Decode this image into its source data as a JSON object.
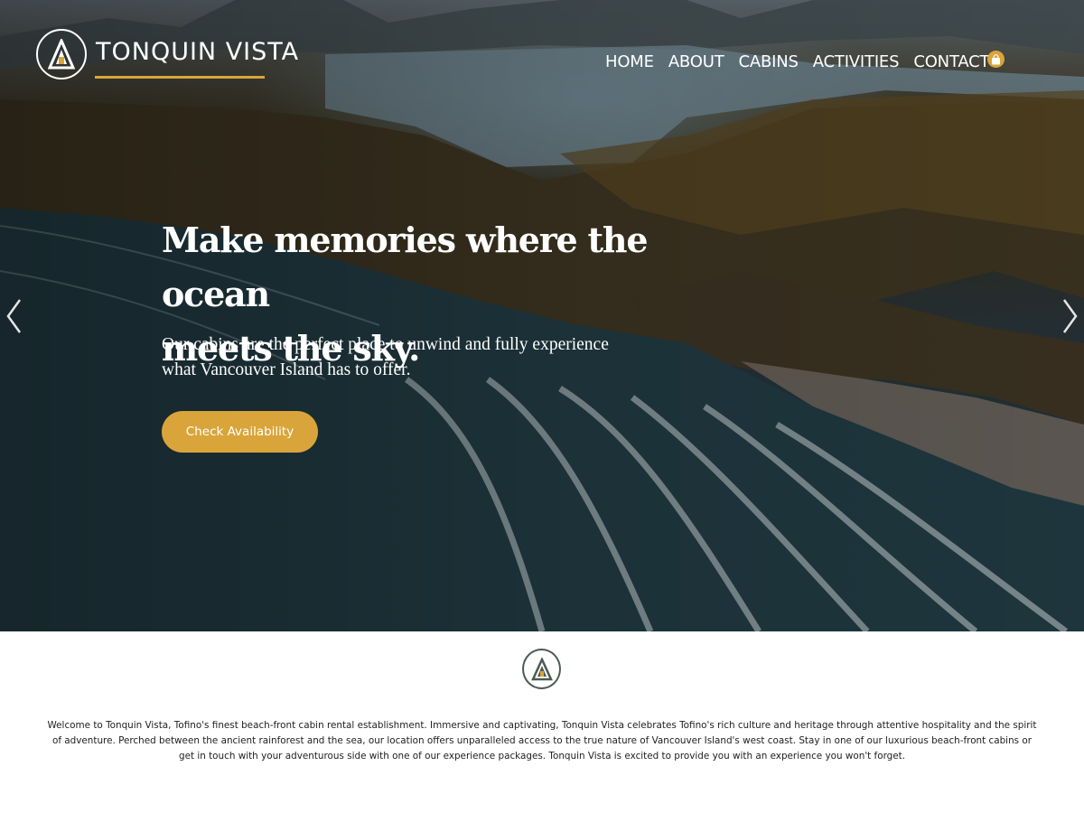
{
  "brand": {
    "name": "TONQUIN VISTA"
  },
  "nav": {
    "items": [
      {
        "label": "HOME"
      },
      {
        "label": "ABOUT"
      },
      {
        "label": "CABINS"
      },
      {
        "label": "ACTIVITIES"
      },
      {
        "label": "CONTACT"
      }
    ],
    "cart_icon": "shopping-bag-icon"
  },
  "hero": {
    "title_line1": "Make memories where the ocean",
    "title_line2": "meets the sky.",
    "subtitle_line1": "Our cabins are the perfect place to unwind and fully experience",
    "subtitle_line2": "what Vancouver Island has to offer.",
    "cta_label": "Check Availability",
    "prev_icon": "chevron-left-icon",
    "next_icon": "chevron-right-icon"
  },
  "intro": {
    "text": "Welcome to Tonquin Vista, Tofino's finest beach-front cabin rental establishment. Immersive and captivating, Tonquin Vista celebrates Tofino's rich culture and heritage through attentive hospitality and the spirit of adventure. Perched between the ancient rainforest and the sea, our location offers unparalleled access to the true nature of Vancouver Island's west coast. Stay in one of our luxurious beach-front cabins or get in touch with your adventurous side with one of our experience packages. Tonquin Vista is excited to provide you with an experience you won't forget."
  },
  "colors": {
    "accent": "#d9a53a",
    "text_dark": "#1e1e1e",
    "logo_green": "#4d5a52"
  }
}
